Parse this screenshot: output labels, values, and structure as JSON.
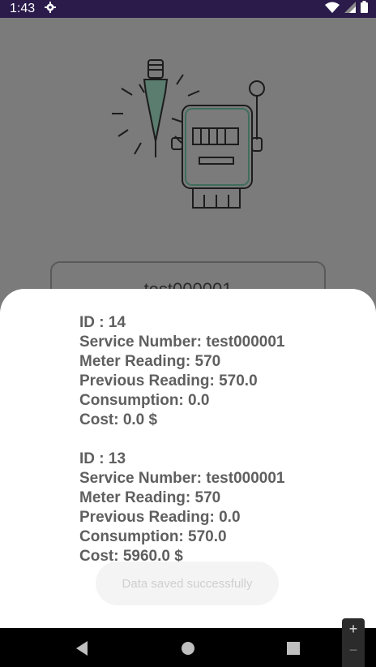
{
  "status_bar": {
    "time": "1:43",
    "icons": [
      "gear-icon",
      "wifi-icon",
      "signal-icon",
      "battery-icon"
    ]
  },
  "background_screen": {
    "service_input_value": "test000001"
  },
  "sheet": {
    "records": [
      {
        "id": "ID : 14",
        "service_number": "Service Number: test000001",
        "meter_reading": "Meter Reading: 570",
        "previous_reading": "Previous Reading: 570.0",
        "consumption": "Consumption: 0.0",
        "cost": "Cost: 0.0 $"
      },
      {
        "id": "ID : 13",
        "service_number": "Service Number: test000001",
        "meter_reading": "Meter Reading: 570",
        "previous_reading": "Previous Reading: 0.0",
        "consumption": "Consumption: 570.0",
        "cost": "Cost: 5960.0 $"
      }
    ]
  },
  "toast": {
    "message": "Data saved successfully"
  },
  "zoom": {
    "plus": "+",
    "minus": "−"
  },
  "colors": {
    "status_bar": "#2a1b4b",
    "scrim": "#7b7b7b",
    "record_text": "#5f5f5f",
    "illustration_accent": "#3f6e5c"
  }
}
